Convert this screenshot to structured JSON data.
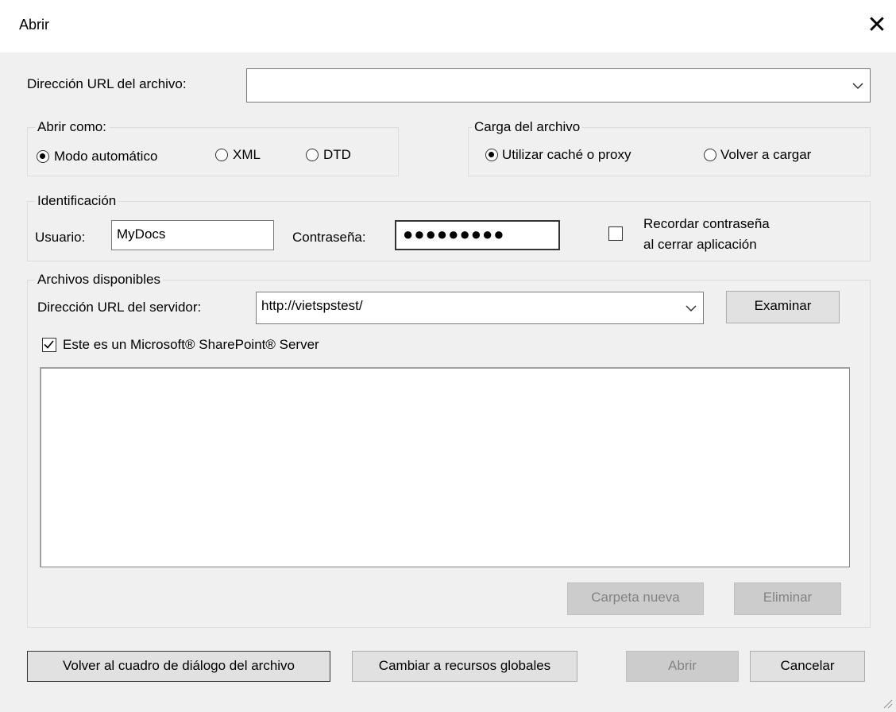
{
  "window": {
    "title": "Abrir",
    "close_glyph": "✕"
  },
  "file_url": {
    "label": "Dirección URL del archivo:",
    "value": ""
  },
  "open_as": {
    "title": "Abrir como:",
    "options": [
      {
        "label": "Modo automático",
        "selected": true
      },
      {
        "label": "XML",
        "selected": false
      },
      {
        "label": "DTD",
        "selected": false
      }
    ]
  },
  "file_load": {
    "title": "Carga del archivo",
    "options": [
      {
        "label": "Utilizar caché o proxy",
        "selected": true
      },
      {
        "label": "Volver a cargar",
        "selected": false
      }
    ]
  },
  "identification": {
    "title": "Identificación",
    "user_label": "Usuario:",
    "user_value": "MyDocs",
    "password_label": "Contraseña:",
    "password_masked": "●●●●●●●●●",
    "remember_line1": "Recordar contraseña",
    "remember_line2": "al cerrar aplicación",
    "remember_checked": false
  },
  "available_files": {
    "title": "Archivos disponibles",
    "server_url_label": "Dirección URL del servidor:",
    "server_url_value": "http://vietspstest/",
    "browse_label": "Examinar",
    "sharepoint_label": "Este es un Microsoft® SharePoint® Server",
    "sharepoint_checked": true,
    "new_folder_label": "Carpeta nueva",
    "delete_label": "Eliminar"
  },
  "footer": {
    "back_label": "Volver al cuadro de diálogo del archivo",
    "global_label": "Cambiar a recursos globales",
    "open_label": "Abrir",
    "cancel_label": "Cancelar"
  }
}
